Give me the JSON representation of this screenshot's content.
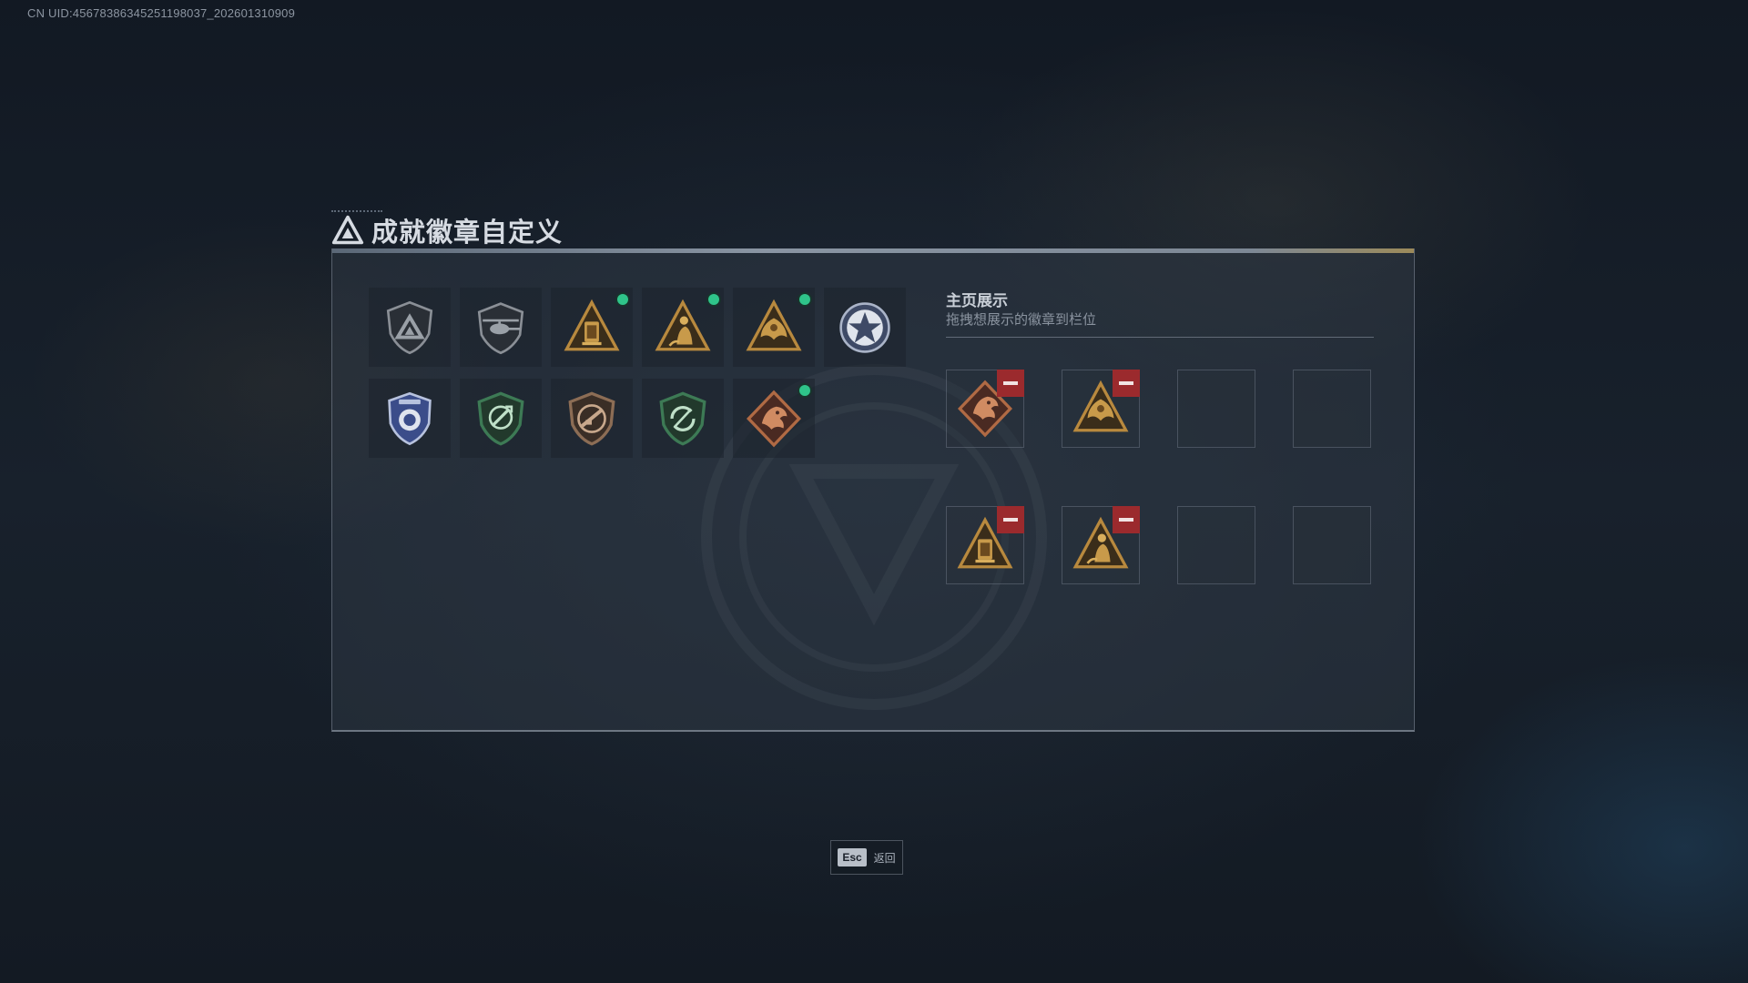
{
  "header": {
    "uid_text": "CN UID:4567838634525119803​7_202601310909"
  },
  "page": {
    "title": "成就徽章自定义",
    "title_icon": "triangle-emblem-icon"
  },
  "owned_badges": [
    {
      "icon": "shield-triangle-badge-icon",
      "is_new": false
    },
    {
      "icon": "helicopter-shield-badge-icon",
      "is_new": false
    },
    {
      "icon": "gold-lantern-triangle-badge-icon",
      "is_new": true
    },
    {
      "icon": "gold-figure-triangle-badge-icon",
      "is_new": true
    },
    {
      "icon": "gold-phoenix-triangle-badge-icon",
      "is_new": true
    },
    {
      "icon": "star-seal-badge-icon",
      "is_new": false
    },
    {
      "icon": "police-shield-badge-icon",
      "is_new": false
    },
    {
      "icon": "green-crosshair-shield-badge-icon",
      "is_new": false
    },
    {
      "icon": "bronze-rifle-shield-badge-icon",
      "is_new": false
    },
    {
      "icon": "green-rotate-shield-badge-icon",
      "is_new": false
    },
    {
      "icon": "red-dragon-diamond-badge-icon",
      "is_new": true
    }
  ],
  "display": {
    "title": "主页展示",
    "subtitle": "拖拽想展示的徽章到栏位",
    "slots": [
      {
        "icon": "red-dragon-diamond-badge-icon",
        "filled": true
      },
      {
        "icon": "gold-phoenix-triangle-badge-icon",
        "filled": true
      },
      {
        "icon": "",
        "filled": false
      },
      {
        "icon": "",
        "filled": false
      },
      {
        "icon": "gold-lantern-triangle-badge-icon",
        "filled": true
      },
      {
        "icon": "gold-figure-triangle-badge-icon",
        "filled": true
      },
      {
        "icon": "",
        "filled": false
      },
      {
        "icon": "",
        "filled": false
      }
    ]
  },
  "footer": {
    "key": "Esc",
    "label": "返回"
  },
  "colors": {
    "new_indicator": "#2fc48a",
    "remove_button": "#9b2a2d",
    "gold_badge": "#b8893e",
    "green_badge": "#3d7a55"
  }
}
